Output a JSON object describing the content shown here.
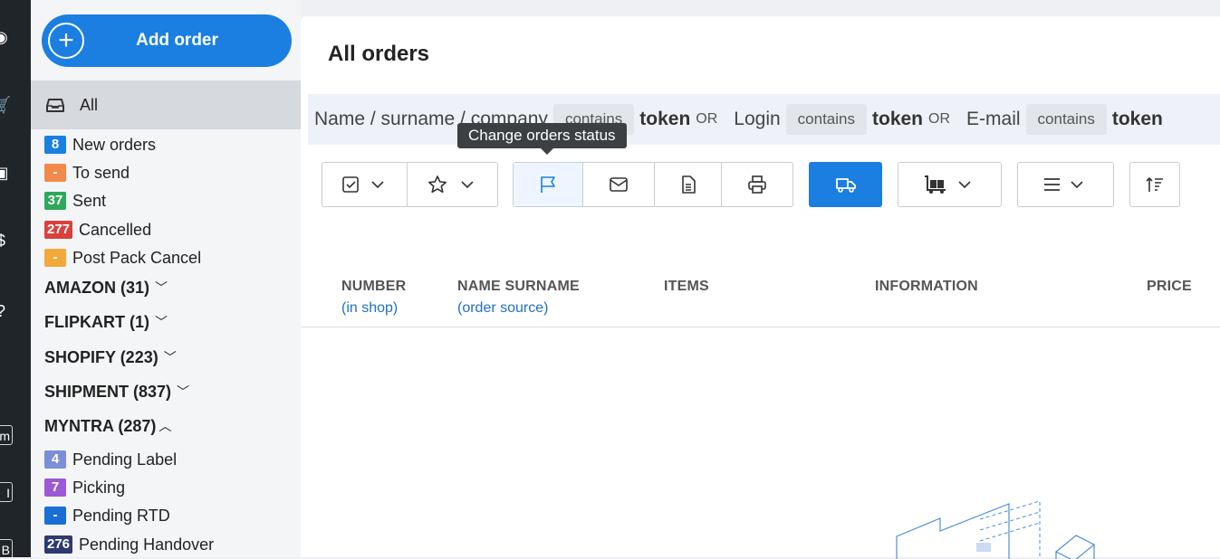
{
  "rail": {
    "items": [
      "palette-icon",
      "cart-icon",
      "box-icon",
      "settlement-icon",
      "help-icon"
    ],
    "boxes": [
      "m",
      "I",
      "B"
    ]
  },
  "sidebar": {
    "add_order": "Add order",
    "all_label": "All",
    "statuses": [
      {
        "count": "8",
        "label": "New orders",
        "color": "#1a7fe0"
      },
      {
        "count": "-",
        "label": "To send",
        "color": "#f08a4b"
      },
      {
        "count": "37",
        "label": "Sent",
        "color": "#2ea85a"
      },
      {
        "count": "277",
        "label": "Cancelled",
        "color": "#d9413a"
      },
      {
        "count": "-",
        "label": "Post Pack Cancel",
        "color": "#f2a93b"
      }
    ],
    "groups": [
      {
        "label": "AMAZON (31)",
        "expanded": false
      },
      {
        "label": "FLIPKART (1)",
        "expanded": false
      },
      {
        "label": "SHOPIFY (223)",
        "expanded": false
      },
      {
        "label": "SHIPMENT (837)",
        "expanded": false
      },
      {
        "label": "MYNTRA (287)",
        "expanded": true
      }
    ],
    "myntra_statuses": [
      {
        "count": "4",
        "label": "Pending Label",
        "color": "#7b8fd9"
      },
      {
        "count": "7",
        "label": "Picking",
        "color": "#9b59d6"
      },
      {
        "count": "-",
        "label": "Pending RTD",
        "color": "#1a6fd6"
      },
      {
        "count": "276",
        "label": "Pending Handover",
        "color": "#2e3a6e"
      }
    ]
  },
  "main": {
    "title": "All orders",
    "filters": [
      {
        "label": "Name / surname / company",
        "op": "contains",
        "token": "token",
        "joiner": "OR"
      },
      {
        "label": "Login",
        "op": "contains",
        "token": "token",
        "joiner": "OR"
      },
      {
        "label": "E-mail",
        "op": "contains",
        "token": "token",
        "joiner": ""
      }
    ],
    "tooltip": "Change orders status",
    "columns": [
      {
        "title": "NUMBER",
        "sub": "(in shop)"
      },
      {
        "title": "NAME SURNAME",
        "sub": "(order source)"
      },
      {
        "title": "ITEMS",
        "sub": ""
      },
      {
        "title": "INFORMATION",
        "sub": ""
      },
      {
        "title": "PRICE",
        "sub": ""
      }
    ]
  },
  "colors": {
    "accent": "#1a7fe0",
    "rail": "#1f2529",
    "sidebar": "#f4f5f7"
  }
}
